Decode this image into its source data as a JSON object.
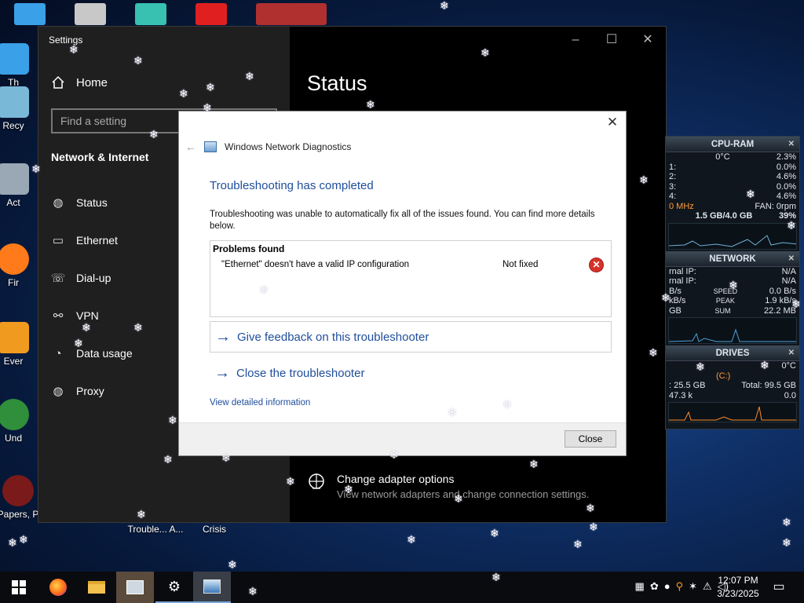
{
  "desktop": {
    "icons": [
      {
        "label": "Th",
        "color": "#3aa0e8"
      },
      {
        "label": "Recy",
        "color": "#7ab8d8"
      },
      {
        "label": "Act",
        "color": "#9aa8b6"
      },
      {
        "label": "Fir",
        "color": "#ff7a1a"
      },
      {
        "label": "Ever",
        "color": "#f09a20"
      },
      {
        "label": "Und",
        "color": "#2f8f3a"
      },
      {
        "label": "Papers, P",
        "color": "#7a1a1a"
      }
    ],
    "bottom_labels": [
      "Trouble... A...",
      "Crisis"
    ],
    "snowflake": "❄"
  },
  "settings": {
    "title": "Settings",
    "home_label": "Home",
    "search_placeholder": "Find a setting",
    "section_title": "Network & Internet",
    "nav": [
      {
        "label": "Status",
        "icon": "globe-icon"
      },
      {
        "label": "Ethernet",
        "icon": "ethernet-icon"
      },
      {
        "label": "Dial-up",
        "icon": "dialup-icon"
      },
      {
        "label": "VPN",
        "icon": "vpn-icon"
      },
      {
        "label": "Data usage",
        "icon": "data-usage-icon"
      },
      {
        "label": "Proxy",
        "icon": "globe-icon"
      }
    ],
    "page_title": "Status",
    "adapter": {
      "title": "Change adapter options",
      "subtitle": "View network adapters and change connection settings."
    }
  },
  "dialog": {
    "app_title": "Windows Network Diagnostics",
    "heading": "Troubleshooting has completed",
    "description": "Troubleshooting was unable to automatically fix all of the issues found. You can find more details below.",
    "problems_header": "Problems found",
    "problem": {
      "description": "\"Ethernet\" doesn't have a valid IP configuration",
      "status": "Not fixed"
    },
    "feedback_link": "Give feedback on this troubleshooter",
    "close_link": "Close the troubleshooter",
    "detail_link": "View detailed information",
    "close_button": "Close"
  },
  "gadget": {
    "cpu": {
      "title": "CPU-RAM",
      "temp": "0°C",
      "total": "2.3%",
      "cores": [
        {
          "label": "1:",
          "value": "0.0%"
        },
        {
          "label": "2:",
          "value": "4.6%"
        },
        {
          "label": "3:",
          "value": "0.0%"
        },
        {
          "label": "4:",
          "value": "4.6%"
        }
      ],
      "freq": "0 MHz",
      "fan": "FAN: 0rpm",
      "ram": "1.5 GB/4.0 GB",
      "ram_pct": "39%"
    },
    "network": {
      "title": "NETWORK",
      "internal_ip": {
        "label": "rnal IP:",
        "value": "N/A"
      },
      "external_ip": {
        "label": "rnal IP:",
        "value": "N/A"
      },
      "speed": {
        "left": "B/s",
        "label": "SPEED",
        "value": "0.0 B/s"
      },
      "peak": {
        "left": "kB/s",
        "label": "PEAK",
        "value": "1.9 kB/s"
      },
      "sum": {
        "left": "GB",
        "label": "SUM",
        "value": "22.2 MB"
      }
    },
    "drives": {
      "title": "DRIVES",
      "temp": "0°C",
      "drive": "(C:)",
      "free": ": 25.5 GB",
      "total": "Total: 99.5 GB",
      "read": "47.3 k",
      "write": "0.0"
    }
  },
  "taskbar": {
    "time": "12:07 PM",
    "date": "3/23/2025"
  }
}
